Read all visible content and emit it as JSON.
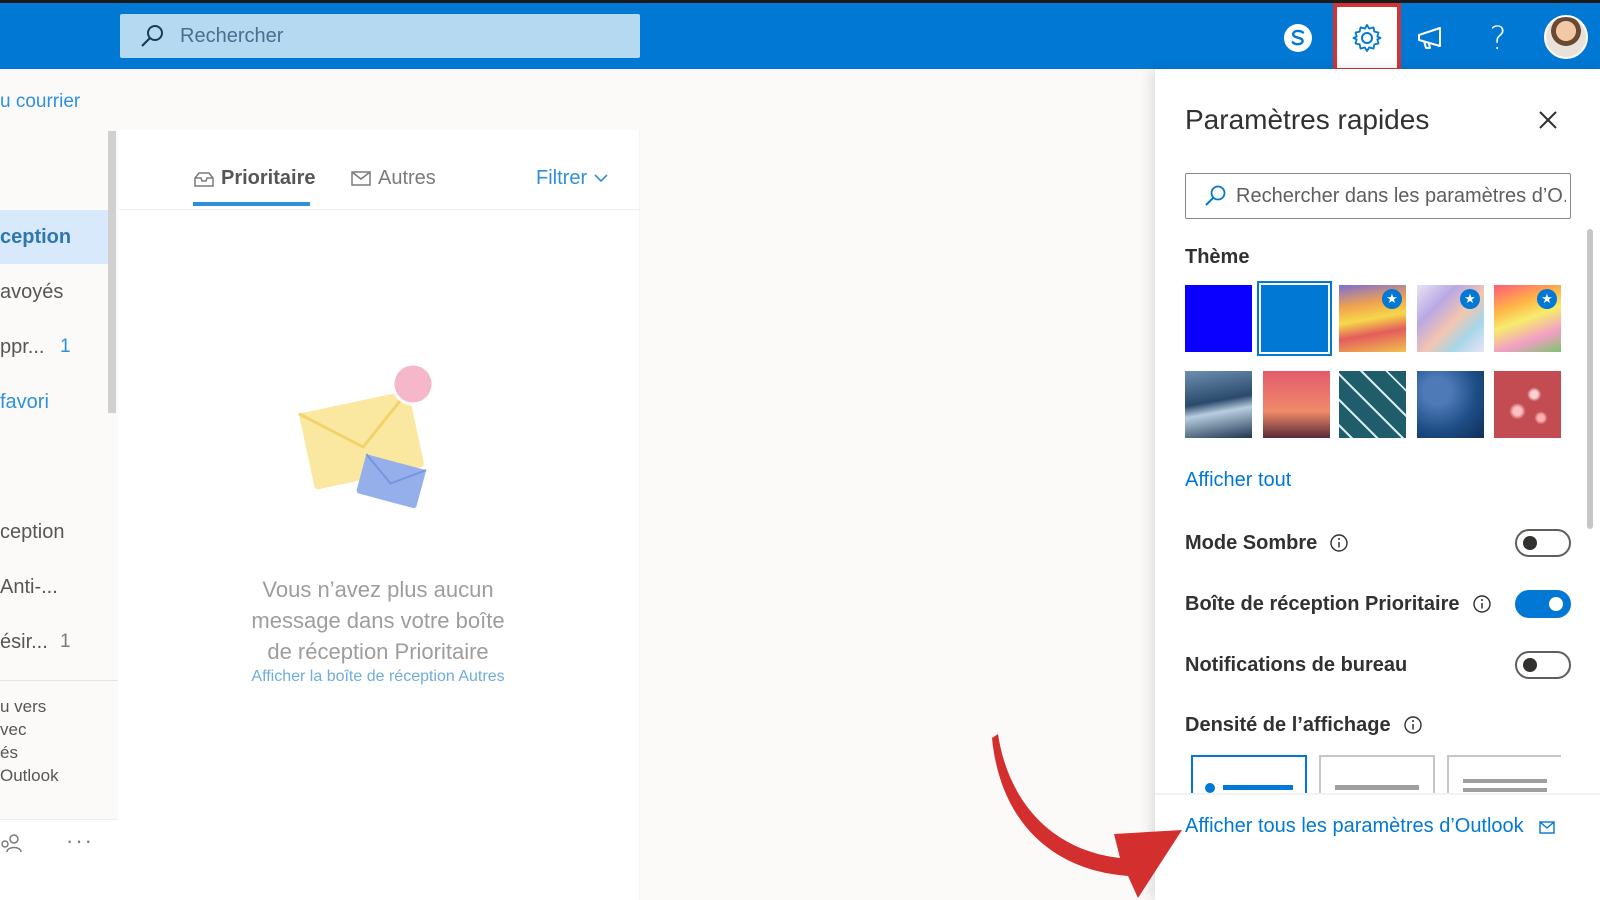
{
  "search": {
    "placeholder": "Rechercher"
  },
  "topbar": {
    "icons": [
      "skype-icon",
      "settings-gear-icon",
      "megaphone-icon",
      "help-icon"
    ],
    "help_glyph": "?"
  },
  "leftnav": {
    "new_mail_label": "u courrier",
    "folders": [
      {
        "label": "ception",
        "count": "",
        "active": true
      },
      {
        "label": "avoyés",
        "count": ""
      },
      {
        "label": "ppr...",
        "count": "1"
      },
      {
        "label": "favori",
        "count": ""
      },
      {
        "label": "ception",
        "count": ""
      },
      {
        "label": "Anti-...",
        "count": ""
      },
      {
        "label": "ésir...",
        "count": "1"
      }
    ],
    "promo_lines": [
      "u vers",
      "vec",
      "és",
      "Outlook"
    ],
    "more_label": "···"
  },
  "message_list": {
    "tabs": [
      {
        "label": "Prioritaire",
        "selected": true
      },
      {
        "label": "Autres",
        "selected": false
      }
    ],
    "filter_label": "Filtrer",
    "empty_state_lines": [
      "Vous n’avez plus aucun",
      "message dans votre boîte",
      "de réception Prioritaire"
    ],
    "empty_state_link": "Afficher la boîte de réception Autres"
  },
  "quick_settings": {
    "title": "Paramètres rapides",
    "search_placeholder": "Rechercher dans les paramètres d’O...",
    "theme_label": "Thème",
    "themes": [
      {
        "name": "blue-solid",
        "color": "#0a00ff",
        "starred": false,
        "selected": false
      },
      {
        "name": "azure-solid",
        "color": "#0078d4",
        "starred": false,
        "selected": true
      },
      {
        "name": "rainbow-waves",
        "color": "#f2c14e",
        "starred": true,
        "selected": false
      },
      {
        "name": "pastel-ribbons",
        "color": "#c9b6e4",
        "starred": true,
        "selected": false
      },
      {
        "name": "unicorn",
        "color": "#f29fc5",
        "starred": true,
        "selected": false
      },
      {
        "name": "wave",
        "color": "#2b4a6b",
        "starred": false,
        "selected": false
      },
      {
        "name": "palm-sunset",
        "color": "#e06a6a",
        "starred": false,
        "selected": false
      },
      {
        "name": "circuit",
        "color": "#1f5d6b",
        "starred": false,
        "selected": false
      },
      {
        "name": "coin",
        "color": "#1d4d85",
        "starred": false,
        "selected": false
      },
      {
        "name": "bokeh",
        "color": "#c85a5a",
        "starred": false,
        "selected": false
      }
    ],
    "show_all_label": "Afficher tout",
    "toggles": [
      {
        "label": "Mode Sombre",
        "on": false,
        "info": true
      },
      {
        "label": "Boîte de réception Prioritaire",
        "on": true,
        "info": true
      },
      {
        "label": "Notifications de bureau",
        "on": false,
        "info": false
      }
    ],
    "density_label": "Densité de l’affichage",
    "all_settings_label": "Afficher tous les paramètres d’Outlook"
  },
  "colors": {
    "accent": "#0078d4",
    "highlight_box": "#d13438",
    "annotation_arrow": "#d32f2f"
  }
}
